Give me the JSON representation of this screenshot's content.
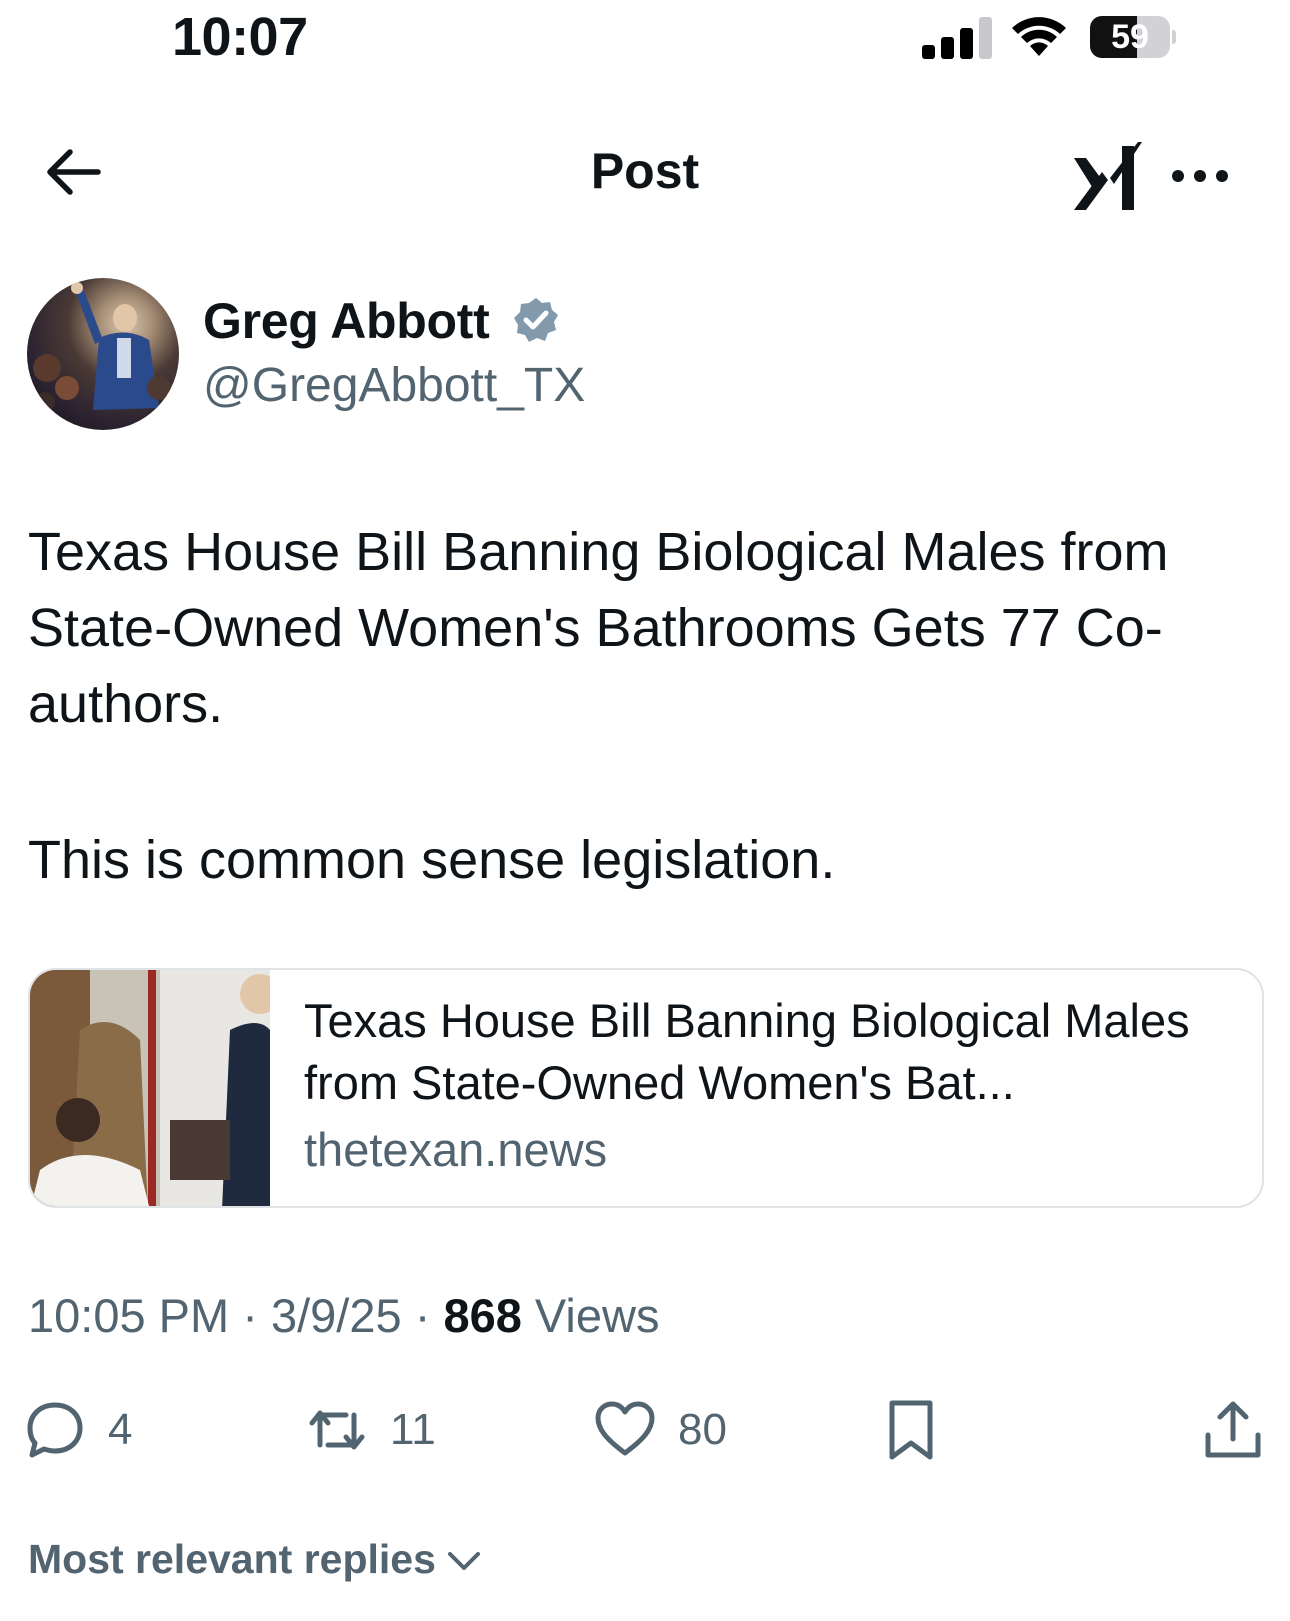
{
  "status_bar": {
    "time": "10:07",
    "battery_level": "59",
    "signal_bars_active": 3,
    "signal_bars_total": 4
  },
  "nav": {
    "back_icon": "arrow-left-icon",
    "title": "Post",
    "grok_icon": "grok-icon",
    "more_icon": "more-horizontal-icon"
  },
  "author": {
    "name": "Greg Abbott",
    "handle": "@GregAbbott_TX",
    "verified_icon": "verified-badge-icon",
    "verified_color": "#829aab"
  },
  "tweet": {
    "text": "Texas House Bill Banning Biological Males from State-Owned Women's Bathrooms Gets 77 Co-authors.",
    "text_2": "This is common sense legislation."
  },
  "link_card": {
    "title": "Texas House Bill Banning Biological Males from State-Owned Women's Bat...",
    "domain": "thetexan.news"
  },
  "meta": {
    "time": "10:05 PM",
    "separator": "·",
    "date": "3/9/25",
    "views_count": "868",
    "views_label": "Views"
  },
  "actions": {
    "reply_count": "4",
    "retweet_count": "11",
    "like_count": "80"
  },
  "replies": {
    "sort_label": "Most relevant replies"
  },
  "colors": {
    "text_primary": "#0f1419",
    "text_secondary": "#536471",
    "border": "#dfe3e6"
  }
}
